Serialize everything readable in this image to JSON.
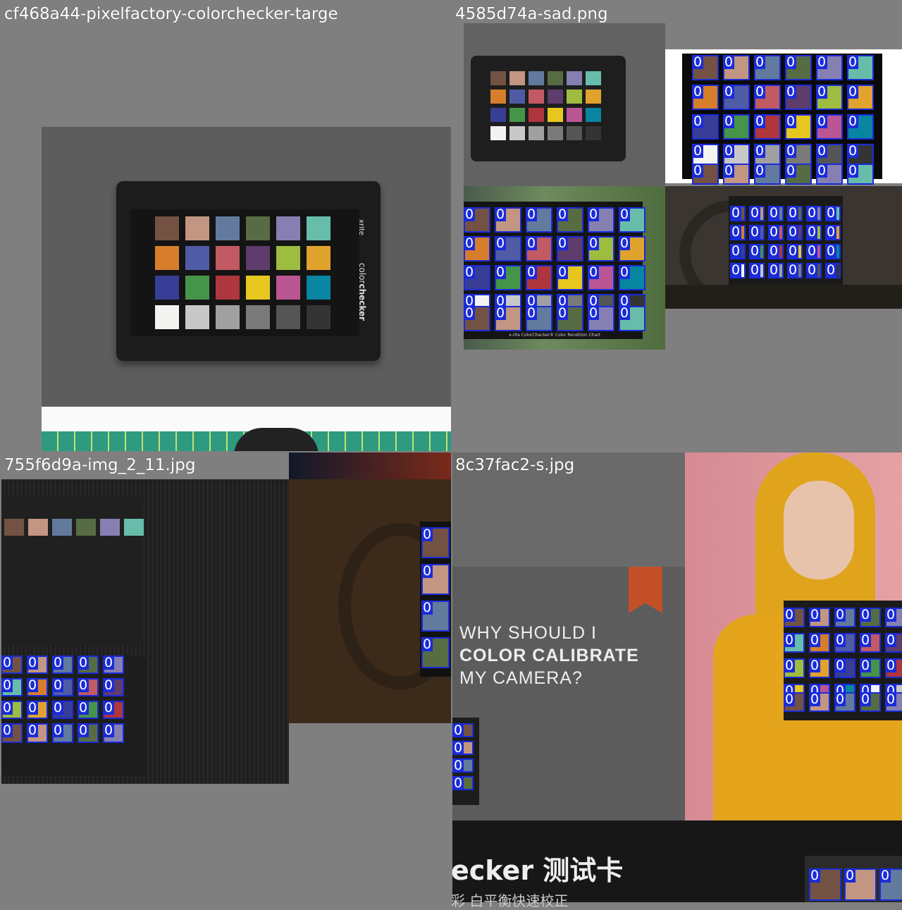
{
  "tiles": [
    {
      "label": "cf468a44-pixelfactory-colorchecker-targe"
    },
    {
      "label": "4585d74a-sad.png"
    },
    {
      "label": "755f6d9a-img_2_11.jpg"
    },
    {
      "label": "8c37fac2-s.jpg"
    }
  ],
  "detection_class_label": "0",
  "bbox_color": "#1a2bd9",
  "checker_text": {
    "brand": "xrite",
    "product_prefix": "color",
    "product_suffix": "checker",
    "chart_caption": "x-rite ColorChecker® Color Rendition Chart"
  },
  "poster_text": {
    "line1": "WHY SHOULD I",
    "line2": "COLOR CALIBRATE",
    "line3": "MY CAMERA?",
    "banner": "ecker 测试卡",
    "banner_sub": "彩 白平衡快速校正"
  },
  "colorchecker_palette": [
    "#735244",
    "#c29682",
    "#627a9d",
    "#576c43",
    "#8580b1",
    "#67bdaa",
    "#d67e2c",
    "#505ba6",
    "#c15a63",
    "#5e3c6c",
    "#9dbc40",
    "#e0a32e",
    "#383d96",
    "#469449",
    "#af363c",
    "#e7c71f",
    "#bb5695",
    "#0885a1",
    "#f3f3f2",
    "#c8c8c8",
    "#a0a0a0",
    "#7a7a79",
    "#555555",
    "#343434"
  ]
}
